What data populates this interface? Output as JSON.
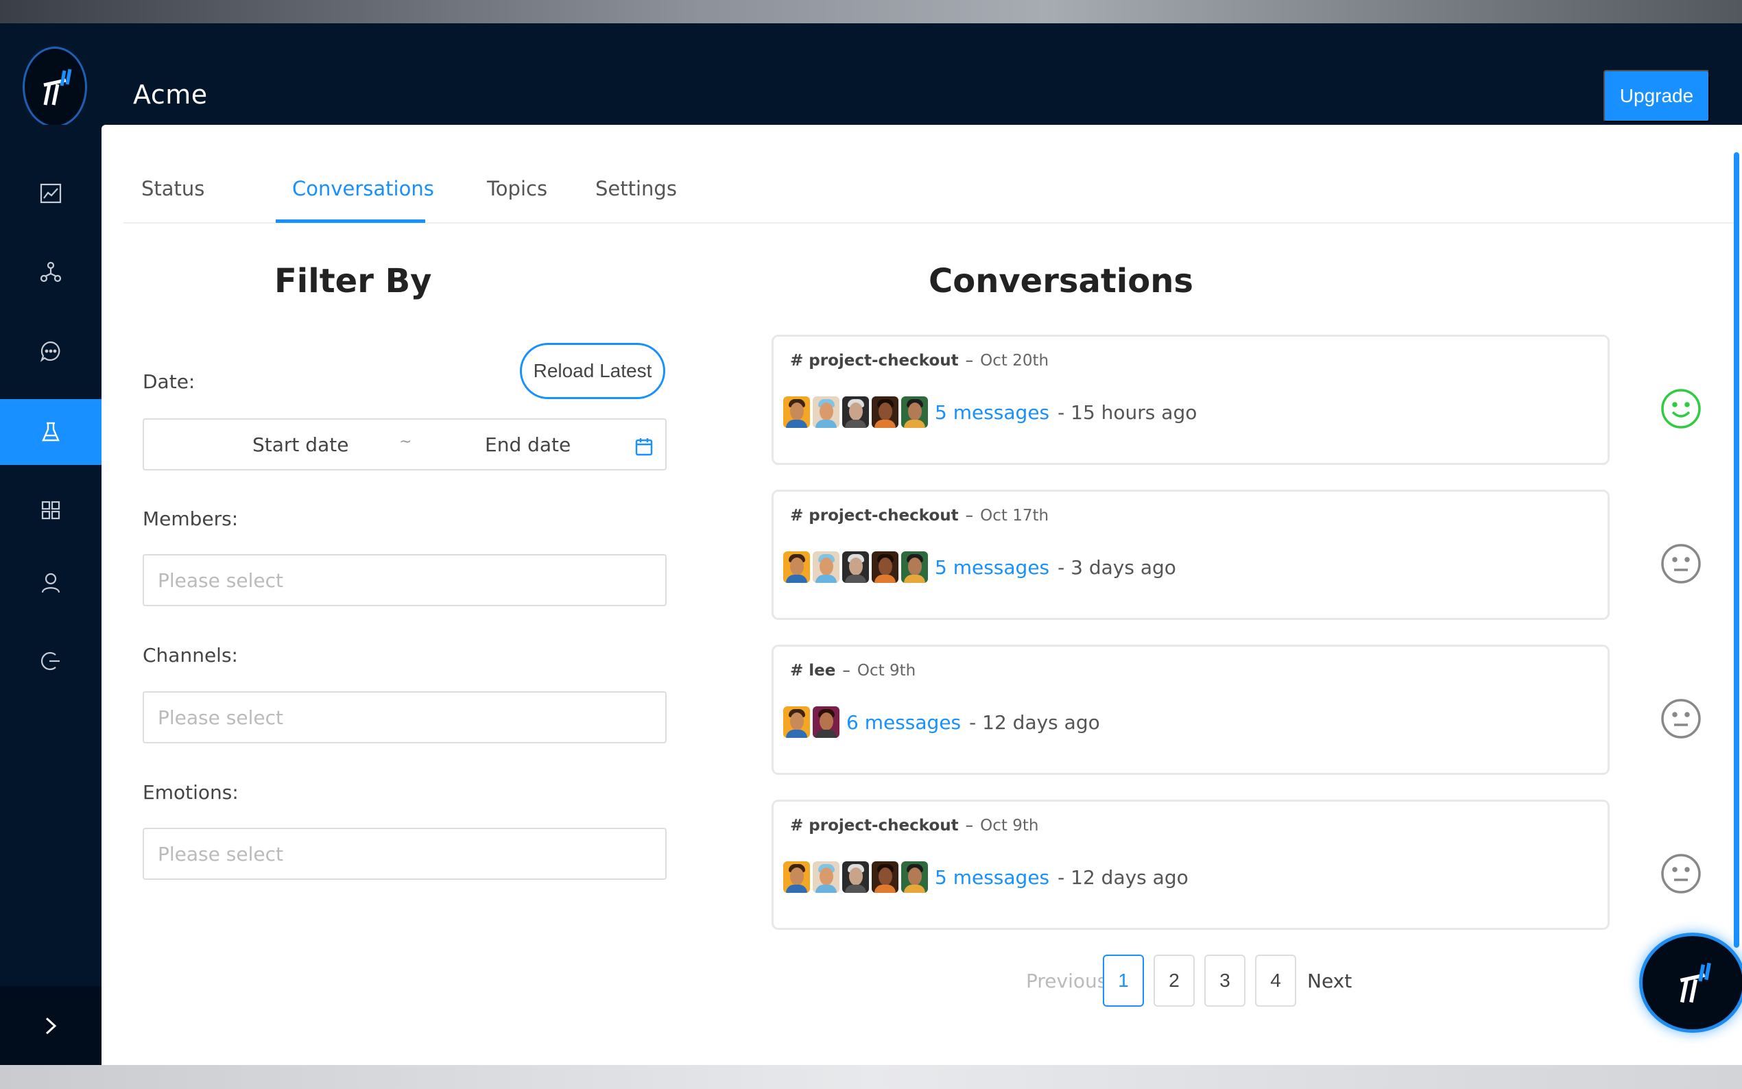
{
  "app": {
    "title": "Acme",
    "upgrade_label": "Upgrade",
    "accent": "#1890ff",
    "logo_icon": "brand-logo-icon"
  },
  "sidebar": {
    "items": [
      {
        "icon": "line-chart-icon",
        "active": false
      },
      {
        "icon": "network-icon",
        "active": false
      },
      {
        "icon": "chat-bubble-icon",
        "active": false
      },
      {
        "icon": "flask-icon",
        "active": true
      },
      {
        "icon": "grid-icon",
        "active": false
      },
      {
        "icon": "user-icon",
        "active": false
      },
      {
        "icon": "logout-icon",
        "active": false
      }
    ],
    "collapse_icon": "chevron-right-icon"
  },
  "tabs": [
    {
      "label": "Status",
      "active": false
    },
    {
      "label": "Conversations",
      "active": true
    },
    {
      "label": "Topics",
      "active": false
    },
    {
      "label": "Settings",
      "active": false
    }
  ],
  "filter": {
    "title": "Filter By",
    "date_label": "Date:",
    "reload_label": "Reload Latest",
    "start_date": "Start date",
    "separator": "~",
    "end_date": "End date",
    "members_label": "Members:",
    "members_placeholder": "Please select",
    "channels_label": "Channels:",
    "channels_placeholder": "Please select",
    "emotions_label": "Emotions:",
    "emotions_placeholder": "Please select"
  },
  "conversations": {
    "title": "Conversations",
    "items": [
      {
        "channel": "# project-checkout",
        "dash": "–",
        "date": "Oct 20th",
        "messages": "5 messages",
        "ago": "- 15 hours ago",
        "emotion": "happy",
        "emotion_color": "#2ecc40",
        "avatars": 5
      },
      {
        "channel": "# project-checkout",
        "dash": "–",
        "date": "Oct 17th",
        "messages": "5 messages",
        "ago": "- 3 days ago",
        "emotion": "neutral",
        "emotion_color": "#888888",
        "avatars": 5
      },
      {
        "channel": "# lee",
        "dash": "–",
        "date": "Oct 9th",
        "messages": "6 messages",
        "ago": "- 12 days ago",
        "emotion": "neutral",
        "emotion_color": "#888888",
        "avatars": 2
      },
      {
        "channel": "# project-checkout",
        "dash": "–",
        "date": "Oct 9th",
        "messages": "5 messages",
        "ago": "- 12 days ago",
        "emotion": "neutral",
        "emotion_color": "#888888",
        "avatars": 5
      }
    ]
  },
  "pagination": {
    "previous": "Previous",
    "pages": [
      "1",
      "2",
      "3",
      "4"
    ],
    "current": "1",
    "next": "Next"
  }
}
